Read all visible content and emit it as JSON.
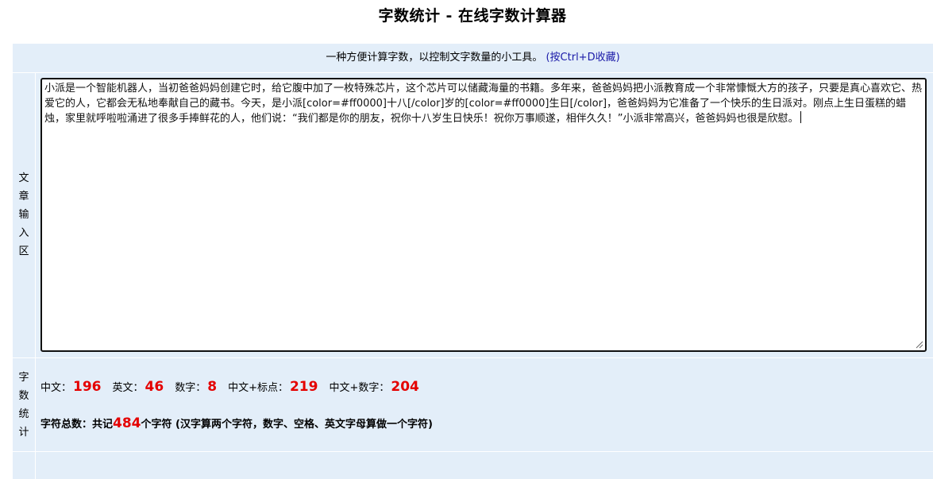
{
  "page": {
    "title": "字数统计 - 在线字数计算器"
  },
  "header": {
    "subtitle": "一种方便计算字数，以控制文字数量的小工具。",
    "hint": "(按Ctrl+D收藏)"
  },
  "input_section": {
    "label": [
      "文",
      "章",
      "输",
      "入",
      "区"
    ],
    "content": "小派是一个智能机器人，当初爸爸妈妈创建它时，给它腹中加了一枚特殊芯片，这个芯片可以储藏海量的书籍。多年来，爸爸妈妈把小派教育成一个非常慷慨大方的孩子，只要是真心喜欢它、热爱它的人，它都会无私地奉献自己的藏书。今天，是小派[color=#ff0000]十八[/color]岁的[color=#ff0000]生日[/color]，爸爸妈妈为它准备了一个快乐的生日派对。刚点上生日蛋糕的蜡烛，家里就呼啦啦涌进了很多手捧鲜花的人，他们说：“我们都是你的朋友，祝你十八岁生日快乐！祝你万事顺遂，相伴久久！”小派非常高兴，爸爸妈妈也很是欣慰。"
  },
  "stats_section": {
    "label": [
      "字",
      "数",
      "统",
      "计"
    ],
    "items": [
      {
        "label": "中文：",
        "value": "196"
      },
      {
        "label": "英文：",
        "value": "46"
      },
      {
        "label": "数字：",
        "value": "8"
      },
      {
        "label": "中文+标点：",
        "value": "219"
      },
      {
        "label": "中文+数字：",
        "value": "204"
      }
    ],
    "total_prefix": "字符总数：共记",
    "total_value": "484",
    "total_suffix": "个字符 (汉字算两个字符，数字、空格、英文字母算做一个字符)"
  },
  "colors": {
    "panel_bg": "#e3eef9",
    "highlight": "#e40000",
    "hint_link": "#1a1aa8"
  }
}
